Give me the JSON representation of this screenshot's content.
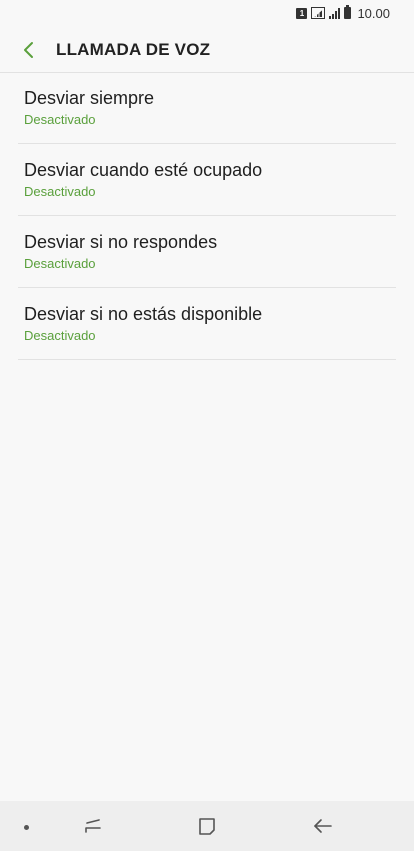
{
  "status_bar": {
    "sim_label": "1",
    "time": "10.00"
  },
  "header": {
    "title": "LLAMADA DE VOZ",
    "back_icon": "chevron-left-icon",
    "accent_color": "#5aa03c"
  },
  "items": [
    {
      "title": "Desviar siempre",
      "status": "Desactivado"
    },
    {
      "title": "Desviar cuando esté ocupado",
      "status": "Desactivado"
    },
    {
      "title": "Desviar si no respondes",
      "status": "Desactivado"
    },
    {
      "title": "Desviar si no estás disponible",
      "status": "Desactivado"
    }
  ],
  "nav_bar": {
    "icons": [
      "dot-icon",
      "recent-apps-icon",
      "home-icon",
      "back-arrow-icon"
    ]
  }
}
